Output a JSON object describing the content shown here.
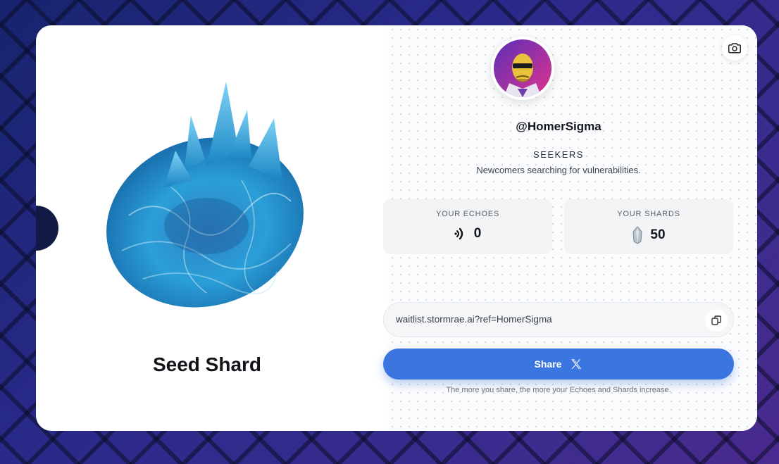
{
  "shard": {
    "title": "Seed Shard",
    "image_icon": "blue-crystal-icon"
  },
  "profile": {
    "username": "@HomerSigma",
    "avatar_icon": "user-avatar",
    "rank": "SEEKERS",
    "rank_description": "Newcomers searching for vulnerabilities."
  },
  "stats": {
    "echoes": {
      "label": "YOUR ECHOES",
      "value": "0",
      "icon": "echo-signal-icon"
    },
    "shards": {
      "label": "YOUR SHARDS",
      "value": "50",
      "icon": "crystal-shard-icon"
    }
  },
  "referral": {
    "link": "waitlist.stormrae.ai?ref=HomerSigma",
    "copy_icon": "copy-icon"
  },
  "share": {
    "label": "Share",
    "icon": "x-logo-icon",
    "hint": "The more you share, the more your Echoes and Shards increase."
  },
  "toolbar": {
    "camera_icon": "camera-icon"
  },
  "colors": {
    "accent": "#3b75e0",
    "background": "#1a1f5e"
  }
}
